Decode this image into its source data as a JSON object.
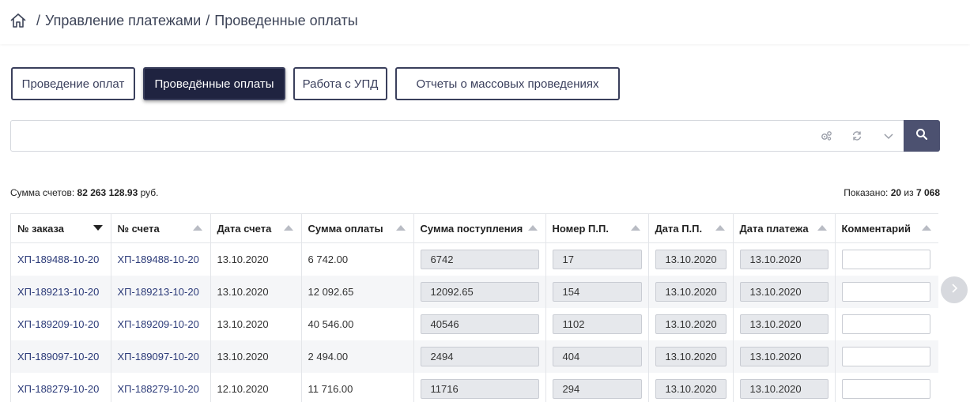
{
  "breadcrumb": {
    "separator": "/",
    "items": [
      "Управление платежами",
      "Проведенные оплаты"
    ]
  },
  "tabs": [
    {
      "label": "Проведение оплат",
      "active": false
    },
    {
      "label": "Проведённые оплаты",
      "active": true
    },
    {
      "label": "Работа с УПД",
      "active": false
    },
    {
      "label": "Отчеты о массовых проведениях",
      "active": false
    }
  ],
  "search": {
    "value": "",
    "placeholder": ""
  },
  "icons": {
    "home": "home-icon",
    "settings": "gears-icon",
    "refresh": "refresh-icon",
    "expand": "chevron-down-icon",
    "search": "search-icon",
    "next": "chevron-right-icon"
  },
  "summary": {
    "label": "Сумма счетов:",
    "amount": "82 263 128.93",
    "currency": "руб."
  },
  "shown": {
    "label": "Показано:",
    "count": "20",
    "of": "из",
    "total": "7 068"
  },
  "table": {
    "columns": [
      "№ заказа",
      "№ счета",
      "Дата счета",
      "Сумма оплаты",
      "Сумма поступления",
      "Номер П.П.",
      "Дата П.П.",
      "Дата платежа",
      "Комментарий"
    ],
    "rows": [
      {
        "order": "ХП-189488-10-20",
        "invoice": "ХП-189488-10-20",
        "invoice_date": "13.10.2020",
        "payment_sum": "6 742.00",
        "receipt_sum": "6742",
        "pp_number": "17",
        "pp_date": "13.10.2020",
        "payment_date": "13.10.2020"
      },
      {
        "order": "ХП-189213-10-20",
        "invoice": "ХП-189213-10-20",
        "invoice_date": "13.10.2020",
        "payment_sum": "12 092.65",
        "receipt_sum": "12092.65",
        "pp_number": "154",
        "pp_date": "13.10.2020",
        "payment_date": "13.10.2020"
      },
      {
        "order": "ХП-189209-10-20",
        "invoice": "ХП-189209-10-20",
        "invoice_date": "13.10.2020",
        "payment_sum": "40 546.00",
        "receipt_sum": "40546",
        "pp_number": "1102",
        "pp_date": "13.10.2020",
        "payment_date": "13.10.2020"
      },
      {
        "order": "ХП-189097-10-20",
        "invoice": "ХП-189097-10-20",
        "invoice_date": "13.10.2020",
        "payment_sum": "2 494.00",
        "receipt_sum": "2494",
        "pp_number": "404",
        "pp_date": "13.10.2020",
        "payment_date": "13.10.2020"
      },
      {
        "order": "ХП-188279-10-20",
        "invoice": "ХП-188279-10-20",
        "invoice_date": "12.10.2020",
        "payment_sum": "11 716.00",
        "receipt_sum": "11716",
        "pp_number": "294",
        "pp_date": "13.10.2020",
        "payment_date": "13.10.2020"
      }
    ]
  },
  "colors": {
    "accent": "#1f2340",
    "search_button": "#4c5170",
    "link": "#2b3a78"
  }
}
